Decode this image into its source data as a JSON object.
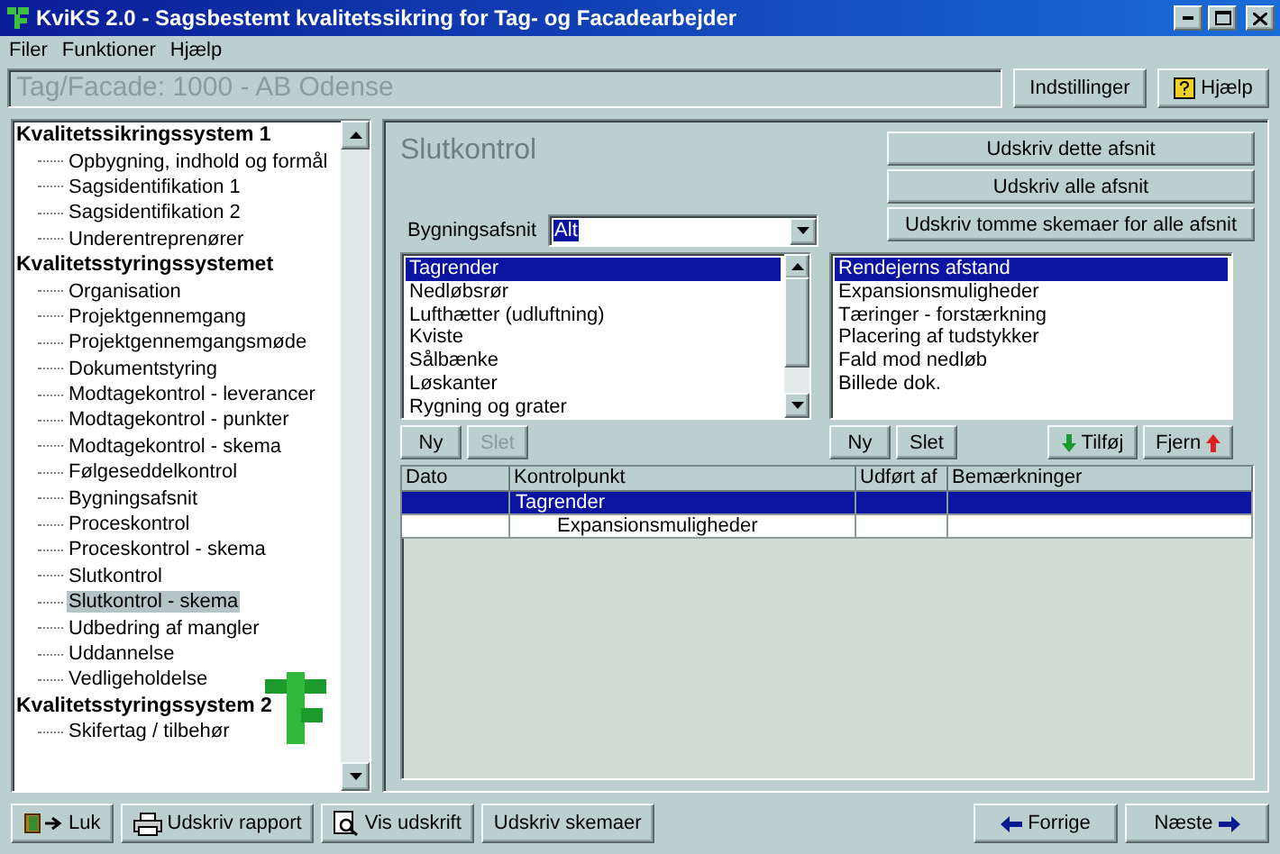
{
  "window": {
    "title": "KviKS 2.0 - Sagsbestemt kvalitetssikring for Tag- og Facadearbejder"
  },
  "menu": [
    "Filer",
    "Funktioner",
    "Hjælp"
  ],
  "header": {
    "case": "Tag/Facade: 1000 - AB Odense",
    "buttons": [
      {
        "label": "Indstillinger",
        "kind": "plain"
      },
      {
        "label": "Hjælp",
        "kind": "help"
      }
    ]
  },
  "tree": [
    {
      "label": "Kvalitetssikringssystem 1",
      "children": [
        {
          "label": "Opbygning, indhold og formål",
          "selected": false
        },
        {
          "label": "Sagsidentifikation 1",
          "selected": false
        },
        {
          "label": "Sagsidentifikation 2",
          "selected": false
        },
        {
          "label": "Underentreprenører",
          "selected": false
        }
      ]
    },
    {
      "label": "Kvalitetsstyringssystemet",
      "children": [
        {
          "label": "Organisation",
          "selected": false
        },
        {
          "label": "Projektgennemgang",
          "selected": false
        },
        {
          "label": "Projektgennemgangsmøde",
          "selected": false
        },
        {
          "label": "Dokumentstyring",
          "selected": false
        },
        {
          "label": "Modtagekontrol - leverancer",
          "selected": false
        },
        {
          "label": "Modtagekontrol - punkter",
          "selected": false
        },
        {
          "label": "Modtagekontrol - skema",
          "selected": false
        },
        {
          "label": "Følgeseddelkontrol",
          "selected": false
        },
        {
          "label": "Bygningsafsnit",
          "selected": false
        },
        {
          "label": "Proceskontrol",
          "selected": false
        },
        {
          "label": "Proceskontrol - skema",
          "selected": false
        },
        {
          "label": "Slutkontrol",
          "selected": false
        },
        {
          "label": "Slutkontrol - skema",
          "selected": true
        },
        {
          "label": "Udbedring af mangler",
          "selected": false
        },
        {
          "label": "Uddannelse",
          "selected": false
        },
        {
          "label": "Vedligeholdelse",
          "selected": false
        }
      ]
    },
    {
      "label": "Kvalitetsstyringssystem 2",
      "children": [
        {
          "label": "Skifertag / tilbehør",
          "selected": false
        }
      ]
    }
  ],
  "section_title": "Slutkontrol",
  "print_buttons": [
    "Udskriv dette afsnit",
    "Udskriv alle afsnit",
    "Udskriv tomme skemaer for alle afsnit"
  ],
  "building_section": {
    "label": "Bygningsafsnit",
    "value": "Alt"
  },
  "parts_list": [
    {
      "label": "Tagrender",
      "selected": true
    },
    {
      "label": "Nedløbsrør",
      "selected": false
    },
    {
      "label": "Lufthætter (udluftning)",
      "selected": false
    },
    {
      "label": "Kviste",
      "selected": false
    },
    {
      "label": "Sålbænke",
      "selected": false
    },
    {
      "label": "Løskanter",
      "selected": false
    },
    {
      "label": "Rygning og grater",
      "selected": false
    }
  ],
  "points_list": [
    {
      "label": "Rendejerns afstand",
      "selected": true
    },
    {
      "label": "Expansionsmuligheder",
      "selected": false
    },
    {
      "label": "Tæringer - forstærkning",
      "selected": false
    },
    {
      "label": "Placering af tudstykker",
      "selected": false
    },
    {
      "label": "Fald mod nedløb",
      "selected": false
    },
    {
      "label": "Billede dok.",
      "selected": false
    }
  ],
  "parts_buttons": [
    {
      "label": "Ny",
      "disabled": false
    },
    {
      "label": "Slet",
      "disabled": true
    }
  ],
  "points_buttons": [
    {
      "label": "Ny",
      "disabled": false,
      "kind": "plain"
    },
    {
      "label": "Slet",
      "disabled": false,
      "kind": "plain"
    },
    {
      "label": "Tilføj",
      "disabled": false,
      "kind": "add"
    },
    {
      "label": "Fjern",
      "disabled": false,
      "kind": "remove"
    }
  ],
  "table": {
    "columns": [
      "Dato",
      "Kontrolpunkt",
      "Udført af",
      "Bemærkninger"
    ],
    "rows": [
      {
        "kind": "part",
        "selected": true,
        "cells": [
          "",
          "Tagrender",
          "",
          ""
        ]
      },
      {
        "kind": "point",
        "selected": false,
        "cells": [
          "",
          "Expansionsmuligheder",
          "",
          ""
        ]
      }
    ]
  },
  "footer": [
    {
      "label": "Luk",
      "kind": "close"
    },
    {
      "label": "Udskriv rapport",
      "kind": "print"
    },
    {
      "label": "Vis udskrift",
      "kind": "preview"
    },
    {
      "label": "Udskriv skemaer",
      "kind": "plain"
    },
    {
      "label": "Forrige",
      "kind": "prev"
    },
    {
      "label": "Næste",
      "kind": "next"
    }
  ]
}
